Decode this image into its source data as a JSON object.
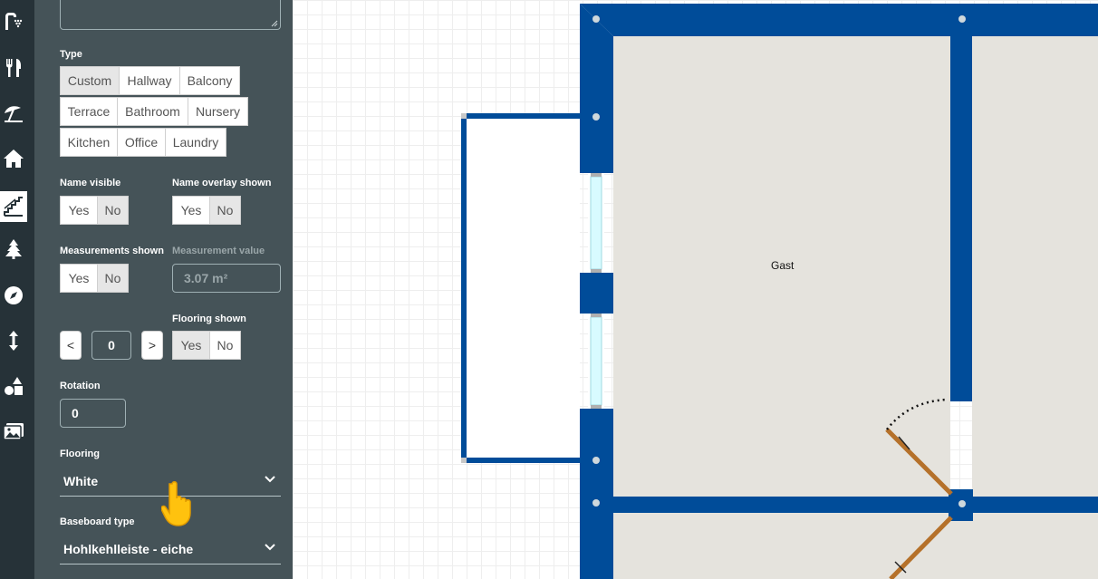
{
  "iconbar": {
    "items": [
      {
        "icon": "shower-icon"
      },
      {
        "icon": "fork-knife-icon"
      },
      {
        "icon": "beach-umbrella-icon"
      },
      {
        "icon": "house-icon"
      },
      {
        "icon": "stairs-icon",
        "active": true
      },
      {
        "icon": "tree-icon"
      },
      {
        "icon": "compass-icon"
      },
      {
        "icon": "vertical-arrows-icon"
      },
      {
        "icon": "shapes-icon"
      },
      {
        "icon": "images-icon"
      }
    ]
  },
  "panel": {
    "type_label": "Type",
    "type_options": [
      "Custom",
      "Hallway",
      "Balcony",
      "Terrace",
      "Bathroom",
      "Nursery",
      "Kitchen",
      "Office",
      "Laundry"
    ],
    "type_selected": "Custom",
    "name_visible": {
      "label": "Name visible",
      "yes": "Yes",
      "no": "No",
      "selected": "No"
    },
    "name_overlay": {
      "label": "Name overlay shown",
      "yes": "Yes",
      "no": "No",
      "selected": "No"
    },
    "measurements_shown": {
      "label": "Measurements shown",
      "yes": "Yes",
      "no": "No",
      "selected": "No"
    },
    "measurement_value": {
      "label": "Measurement value",
      "value": "3.07 m²"
    },
    "stepper": {
      "prev": "<",
      "value": "0",
      "next": ">"
    },
    "flooring_shown": {
      "label": "Flooring shown",
      "yes": "Yes",
      "no": "No",
      "selected": "Yes"
    },
    "rotation": {
      "label": "Rotation",
      "value": "0"
    },
    "flooring": {
      "label": "Flooring",
      "value": "White"
    },
    "baseboard": {
      "label": "Baseboard type",
      "value": "Hohlkehlleiste - eiche"
    }
  },
  "canvas": {
    "room_name": "Gast",
    "colors": {
      "wall": "#004c99",
      "floor": "#e5e3dd",
      "window": "#d8fbff",
      "door": "#b5712a",
      "grid": "#eeeeee"
    }
  }
}
